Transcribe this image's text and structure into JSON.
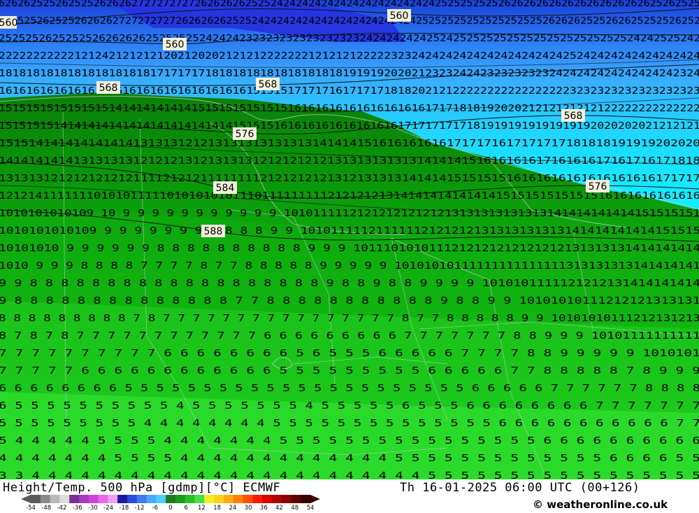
{
  "map": {
    "contour_labels": [
      "560",
      "560",
      "560",
      "568",
      "568",
      "568",
      "576",
      "576",
      "584",
      "588"
    ],
    "temp_rows": [
      "626262525262525262626272727272726262626252524242424242424242424242424252525252526262626262626262626262625262525",
      "252525262525262626272727272726262626252524242424242424242424242424252525252525252525252626262525262625252526252",
      "252525262525252626262625252525242424232323232323232323242424242425242525252525252525252525252524242525242",
      "222222222221212421212121202120202121212222222121212122222323242424242424242424242425242424242424242424",
      "181818181818181818181817171717181818181818181818181919192020212323242423232323232424242424242424242324",
      "161616161616161616161616161616161616151515171717161717171818202121222222222222222223232323232323232323",
      "151515151515151514141414141415151515151515161616161616161616161717181819202021212121212122222222222222",
      "151515151414141414141414141414141415151516161616161616161617171717171819191919191919192020202021212121",
      "1515141414141414141313131212131313131313131414141516161616161717171617171717181818191919202020",
      "1414141414131313131212121312131313121212121213131313131314141415161616161716161617161716171818",
      "1313131212121212121111212121111111121212121213121313131414141515151516161616161616161616171717",
      "121214111111101010111110101010101110111111111212121213141414141414141515151515151516161616161616",
      "1010101010109 10 9 9 9 9 9 9 9 9 9 9 9 101011111212121212121213131313131313141414141414151515151",
      "1010101010109 9 9 9 9 9 9 9 9 8 8 8 9 9 10101111121111112121212131313131313141414141414151515",
      "10101010 9 9 9 9 9 9 8 8 8 8 8 8 8 8 8 8 9 9 9 1011101010111212121212121212131313131414141414",
      "1010 9 9 9 8 8 8 8 7 7 7 7 8 7 7 8 8 8 8 8 9 9 9 9 9 10101010111111111111111313131313141414141",
      "9 9 8 8 8 8 8 8 8 8 8 8 8 8 8 8 8 8 8 8 8 9 8 8 9 8 8 9 9 9 9 1010101111121212131414141414",
      "9 8 8 8 8 8 8 8 8 8 8 8 8 8 8 7 7 8 8 8 8 8 8 8 8 8 8 8 9 8 8 9 9 10101010111212121313131",
      "8 8 8 8 8 8 8 8 8 7 8 7 7 7 7 7 7 7 7 7 7 7 7 7 7 7 7 8 7 7 8 8 8 8 8 9 9 10101010111212131213",
      "8 7 8 7 8 7 7 7 7 7 7 7 7 7 7 7 7 6 6 6 6 6 6 6 6 6 7 7 7 7 7 7 7 8 8 9 9 9 10101111111111",
      "7 7 7 7 7 7 7 7 7 7 6 6 6 6 6 6 6 6 5 6 5 5 5 6 6 6 6 6 7 7 7 7 8 8 9 9 9 9 9 1010101",
      "7 7 7 7 7 6 6 6 6 6 6 6 6 6 6 6 6 5 5 5 5 5 5 5 5 5 6 6 6 6 6 7 7 8 8 8 8 8 7 8 9 9 9",
      "6 6 6 6 6 6 6 6 5 5 5 5 5 5 5 5 5 5 5 5 5 5 5 5 5 5 5 5 5 5 6 6 6 6 6 7 7 7 7 7 7 8 8 8 8",
      "6 5 5 5 5 5 5 5 5 5 5 4 5 5 5 5 5 5 5 4 5 5 5 5 5 6 5 5 5 6 6 6 6 6 6 6 6 7 7 7 7 7 7 7",
      "5 5 5 5 5 5 5 5 5 4 4 4 4 4 4 4 4 5 5 5 5 5 5 5 5 5 5 5 5 5 5 6 6 6 6 6 6 6 6 6 6 6 7 7",
      "5 4 4 4 4 4 5 5 5 5 4 4 4 4 4 4 4 5 5 5 5 5 5 5 5 5 5 5 5 5 5 5 5 6 6 6 6 6 6 6 6 6 6",
      "4 4 4 4 4 4 4 5 5 5 5 4 4 4 4 4 4 4 4 4 4 4 4 4 5 5 5 5 5 5 5 5 5 5 5 5 5 6 6 6 6 5 5",
      "3 3 4 4 4 4 4 4 4 4 4 4 4 4 4 4 4 4 4 4 4 4 4 4 4 4 5 5 5 5 5 5 5 5 5 5 5 5 5 5 5 5 5"
    ]
  },
  "footer": {
    "title": "Height/Temp. 500 hPa [gdmp][°C] ECMWF",
    "valid_time": "Th 16-01-2025 06:00 UTC (00+126)",
    "site": "© weatheronline.co.uk"
  },
  "colorbar": {
    "ticks": [
      "-54",
      "-48",
      "-42",
      "-36",
      "-30",
      "-24",
      "-18",
      "-12",
      "-6",
      "0",
      "6",
      "12",
      "18",
      "24",
      "30",
      "36",
      "42",
      "48",
      "54"
    ],
    "colors": [
      "#5a5a5a",
      "#8a8a8a",
      "#b8b8b8",
      "#dcdcdc",
      "#7a2f96",
      "#a33cc0",
      "#cc44dd",
      "#ee66ee",
      "#f0a0f0",
      "#1a1aa0",
      "#2a4ad8",
      "#3a7cf0",
      "#4aa8ff",
      "#48d0ff",
      "#1e7a1e",
      "#1e9a1e",
      "#24c024",
      "#44e244",
      "#f0f020",
      "#ffd018",
      "#ffaa10",
      "#ff8008",
      "#ff5000",
      "#ff1a00",
      "#d80000",
      "#b00000",
      "#8a0000",
      "#600000",
      "#3a0000"
    ]
  },
  "colors": {
    "field_bands": [
      "#1d4fe0",
      "#35a8ff",
      "#22d4ff",
      "#0a8a08",
      "#0ca40c",
      "#12b812",
      "#14c814",
      "#1ada1a",
      "#2ce82c"
    ]
  }
}
